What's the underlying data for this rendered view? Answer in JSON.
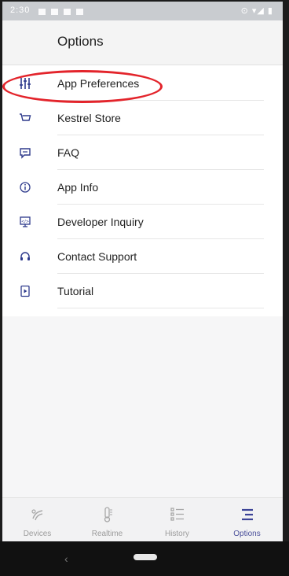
{
  "status_bar": {
    "time": "2:30",
    "right_text": "⊙ ▾◢ ▮"
  },
  "header": {
    "title": "Options"
  },
  "menu": {
    "items": [
      {
        "label": "App Preferences",
        "icon": "sliders-icon"
      },
      {
        "label": "Kestrel Store",
        "icon": "cart-icon"
      },
      {
        "label": "FAQ",
        "icon": "chat-icon"
      },
      {
        "label": "App Info",
        "icon": "info-icon"
      },
      {
        "label": "Developer Inquiry",
        "icon": "monitor-icon"
      },
      {
        "label": "Contact Support",
        "icon": "headset-icon"
      },
      {
        "label": "Tutorial",
        "icon": "tutorial-icon"
      }
    ]
  },
  "bottom_nav": {
    "items": [
      {
        "label": "Devices",
        "icon": "devices-icon"
      },
      {
        "label": "Realtime",
        "icon": "thermometer-icon"
      },
      {
        "label": "History",
        "icon": "history-list-icon"
      },
      {
        "label": "Options",
        "icon": "options-menu-icon"
      }
    ],
    "active": "Options"
  },
  "colors": {
    "accent": "#2e3a8c",
    "annotation_ring": "#e3242b"
  }
}
